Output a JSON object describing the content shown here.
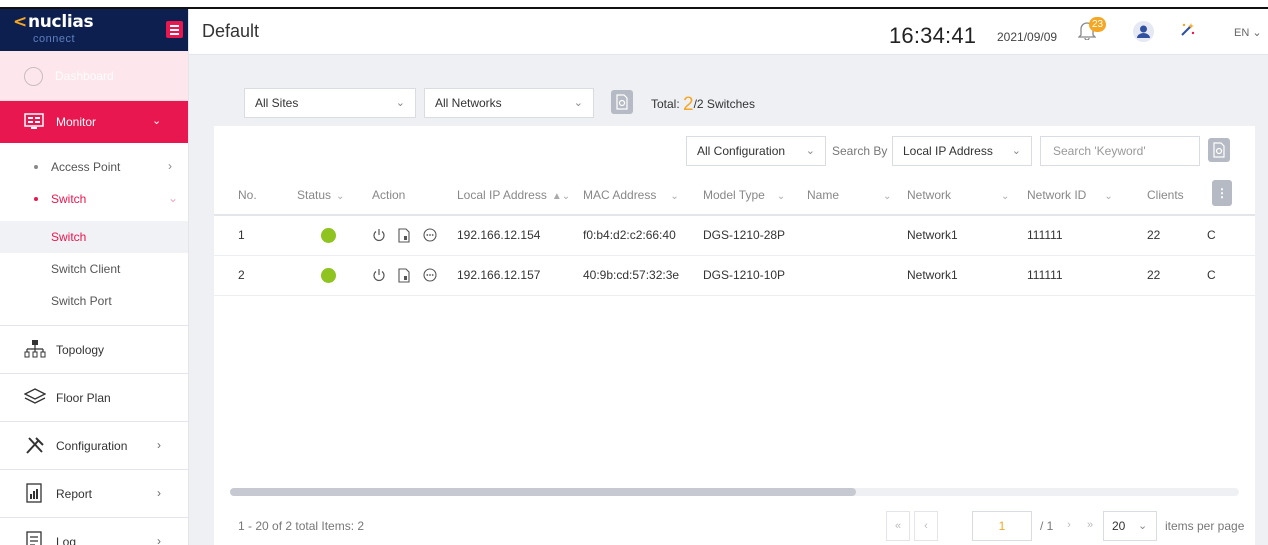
{
  "brand": {
    "name": "nuclias",
    "sub": "connect"
  },
  "nav": {
    "dashboard": "Dashboard",
    "monitor": "Monitor",
    "access_point": "Access Point",
    "switch_group": "Switch",
    "switch_items": [
      "Switch",
      "Switch Client",
      "Switch Port"
    ],
    "topology": "Topology",
    "floor_plan": "Floor Plan",
    "configuration": "Configuration",
    "report": "Report",
    "log": "Log"
  },
  "header": {
    "title": "Default",
    "time": "16:34:41",
    "date": "2021/09/09",
    "notifications": "23",
    "language": "EN"
  },
  "filters": {
    "site": "All Sites",
    "network": "All Networks",
    "total_prefix": "Total: ",
    "total_count": "2",
    "total_suffix": "/2 Switches",
    "config": "All Configuration",
    "search_by_label": "Search By",
    "search_by": "Local IP Address",
    "search_placeholder": "Search 'Keyword'"
  },
  "table": {
    "columns": {
      "no": "No.",
      "status": "Status",
      "action": "Action",
      "ip": "Local IP Address",
      "mac": "MAC Address",
      "model": "Model Type",
      "name": "Name",
      "network": "Network",
      "network_id": "Network ID",
      "clients": "Clients"
    },
    "rows": [
      {
        "no": "1",
        "status": "online",
        "ip": "192.166.12.154",
        "mac": "f0:b4:d2:c2:66:40",
        "model": "DGS-1210-28P",
        "name": "",
        "network": "Network1",
        "network_id": "111111",
        "clients": "22",
        "extra": "C"
      },
      {
        "no": "2",
        "status": "online",
        "ip": "192.166.12.157",
        "mac": "40:9b:cd:57:32:3e",
        "model": "DGS-1210-10P",
        "name": "",
        "network": "Network1",
        "network_id": "111111",
        "clients": "22",
        "extra": "C"
      }
    ]
  },
  "pagination": {
    "summary": "1 - 20 of 2  total Items: 2",
    "first": "«",
    "prev": "‹",
    "current_page": "1",
    "total_pages": "/ 1",
    "next": "›",
    "last": "»",
    "page_size": "20",
    "per_page_label": "items per page"
  },
  "colors": {
    "accent": "#e8174f",
    "brand_bg": "#0d1f4f",
    "highlight": "#f5a623",
    "status_online": "#8fc31f"
  }
}
